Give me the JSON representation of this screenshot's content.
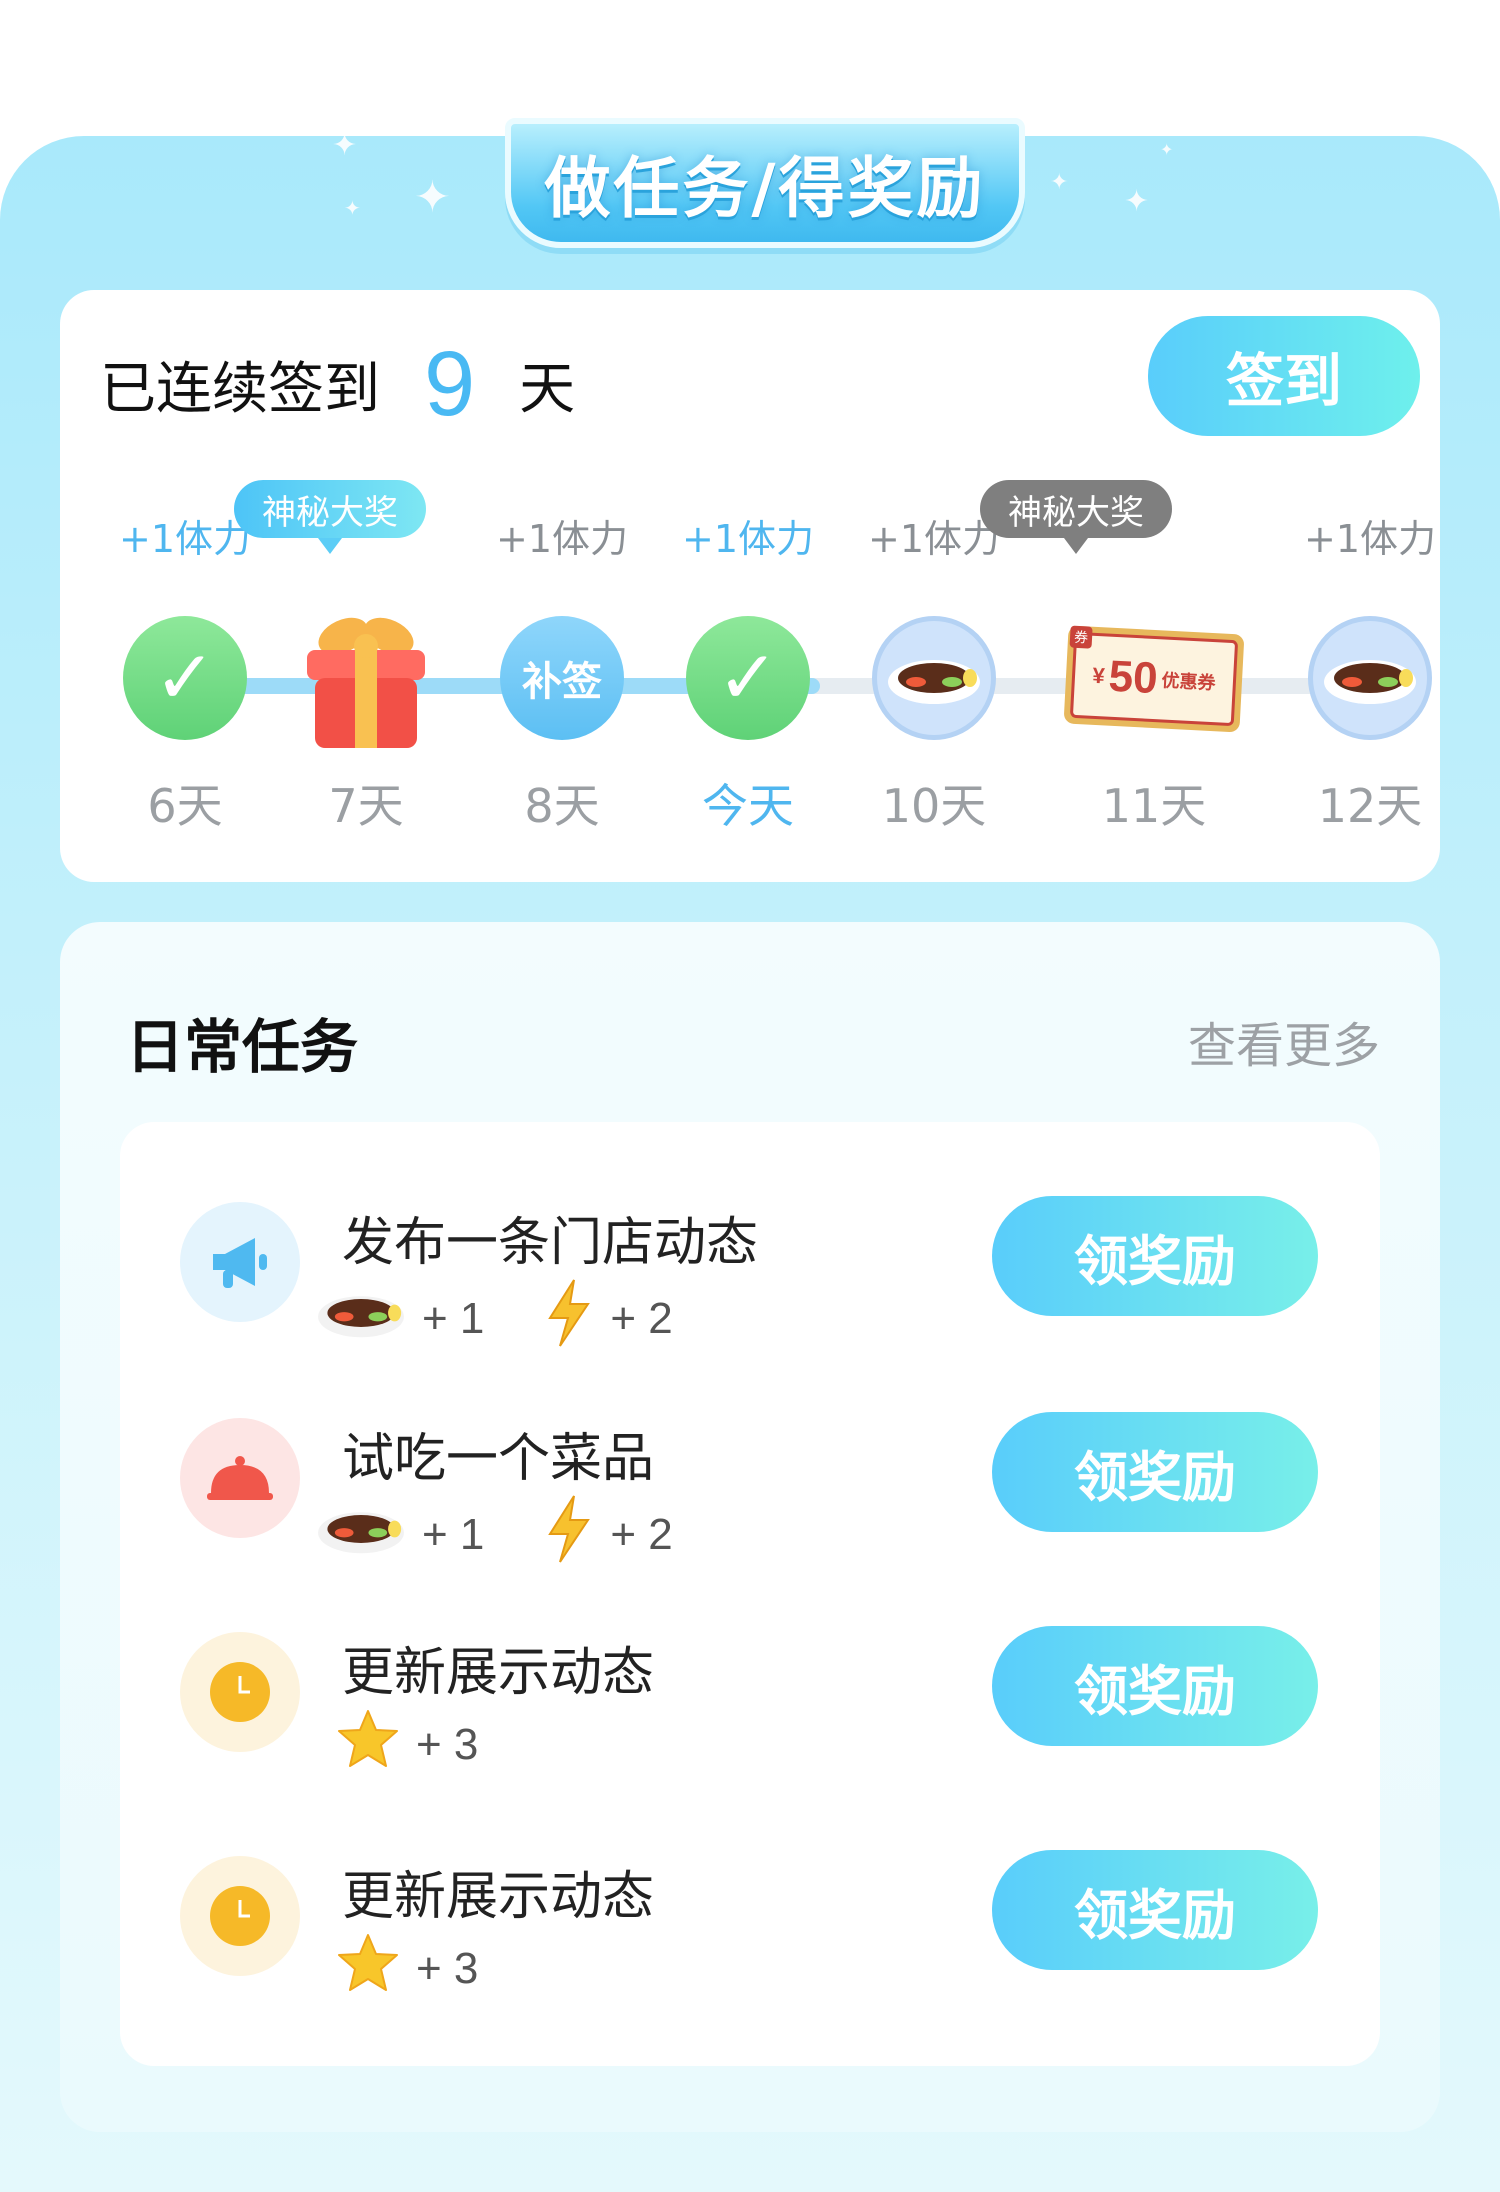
{
  "header": {
    "title": "做任务/得奖励"
  },
  "checkin": {
    "streak_prefix": "已连续签到",
    "streak_days": "9",
    "streak_suffix": "天",
    "button_label": "签到",
    "days": [
      {
        "reward": "+1体力",
        "label": "6天",
        "status": "checked",
        "icon": "check-icon"
      },
      {
        "reward": "",
        "label": "7天",
        "status": "gift",
        "icon": "gift-box-icon",
        "tip": "神秘大奖"
      },
      {
        "reward": "+1体力",
        "label": "8天",
        "status": "makeup",
        "icon": "makeup-badge",
        "badge_text": "补签"
      },
      {
        "reward": "+1体力",
        "label": "今天",
        "status": "today",
        "icon": "check-icon"
      },
      {
        "reward": "+1体力",
        "label": "10天",
        "status": "future",
        "icon": "dish-icon"
      },
      {
        "reward": "",
        "label": "11天",
        "status": "future",
        "icon": "coupon-icon",
        "tip": "神秘大奖"
      },
      {
        "reward": "+1体力",
        "label": "12天",
        "status": "future",
        "icon": "dish-icon"
      }
    ],
    "coupon": {
      "corner": "券",
      "amount": "50",
      "currency": "¥",
      "text": "优惠券"
    }
  },
  "tasks": {
    "title": "日常任务",
    "more_label": "查看更多",
    "items": [
      {
        "name": "发布一条门店动态",
        "icon": "megaphone-icon",
        "rewards": [
          {
            "icon": "dish-icon",
            "value": "+ 1"
          },
          {
            "icon": "lightning-icon",
            "value": "+ 2"
          }
        ],
        "button": "领奖励"
      },
      {
        "name": "试吃一个菜品",
        "icon": "food-cloche-icon",
        "rewards": [
          {
            "icon": "dish-icon",
            "value": "+ 1"
          },
          {
            "icon": "lightning-icon",
            "value": "+ 2"
          }
        ],
        "button": "领奖励"
      },
      {
        "name": "更新展示动态",
        "icon": "clock-icon",
        "rewards": [
          {
            "icon": "star-icon",
            "value": "+ 3"
          }
        ],
        "button": "领奖励"
      },
      {
        "name": "更新展示动态",
        "icon": "clock-icon",
        "rewards": [
          {
            "icon": "star-icon",
            "value": "+ 3"
          }
        ],
        "button": "领奖励"
      }
    ]
  },
  "colors": {
    "accent": "#4fb6ef",
    "check_green": "#6bd67f",
    "button_start": "#59cdfb",
    "button_end": "#72efea"
  }
}
